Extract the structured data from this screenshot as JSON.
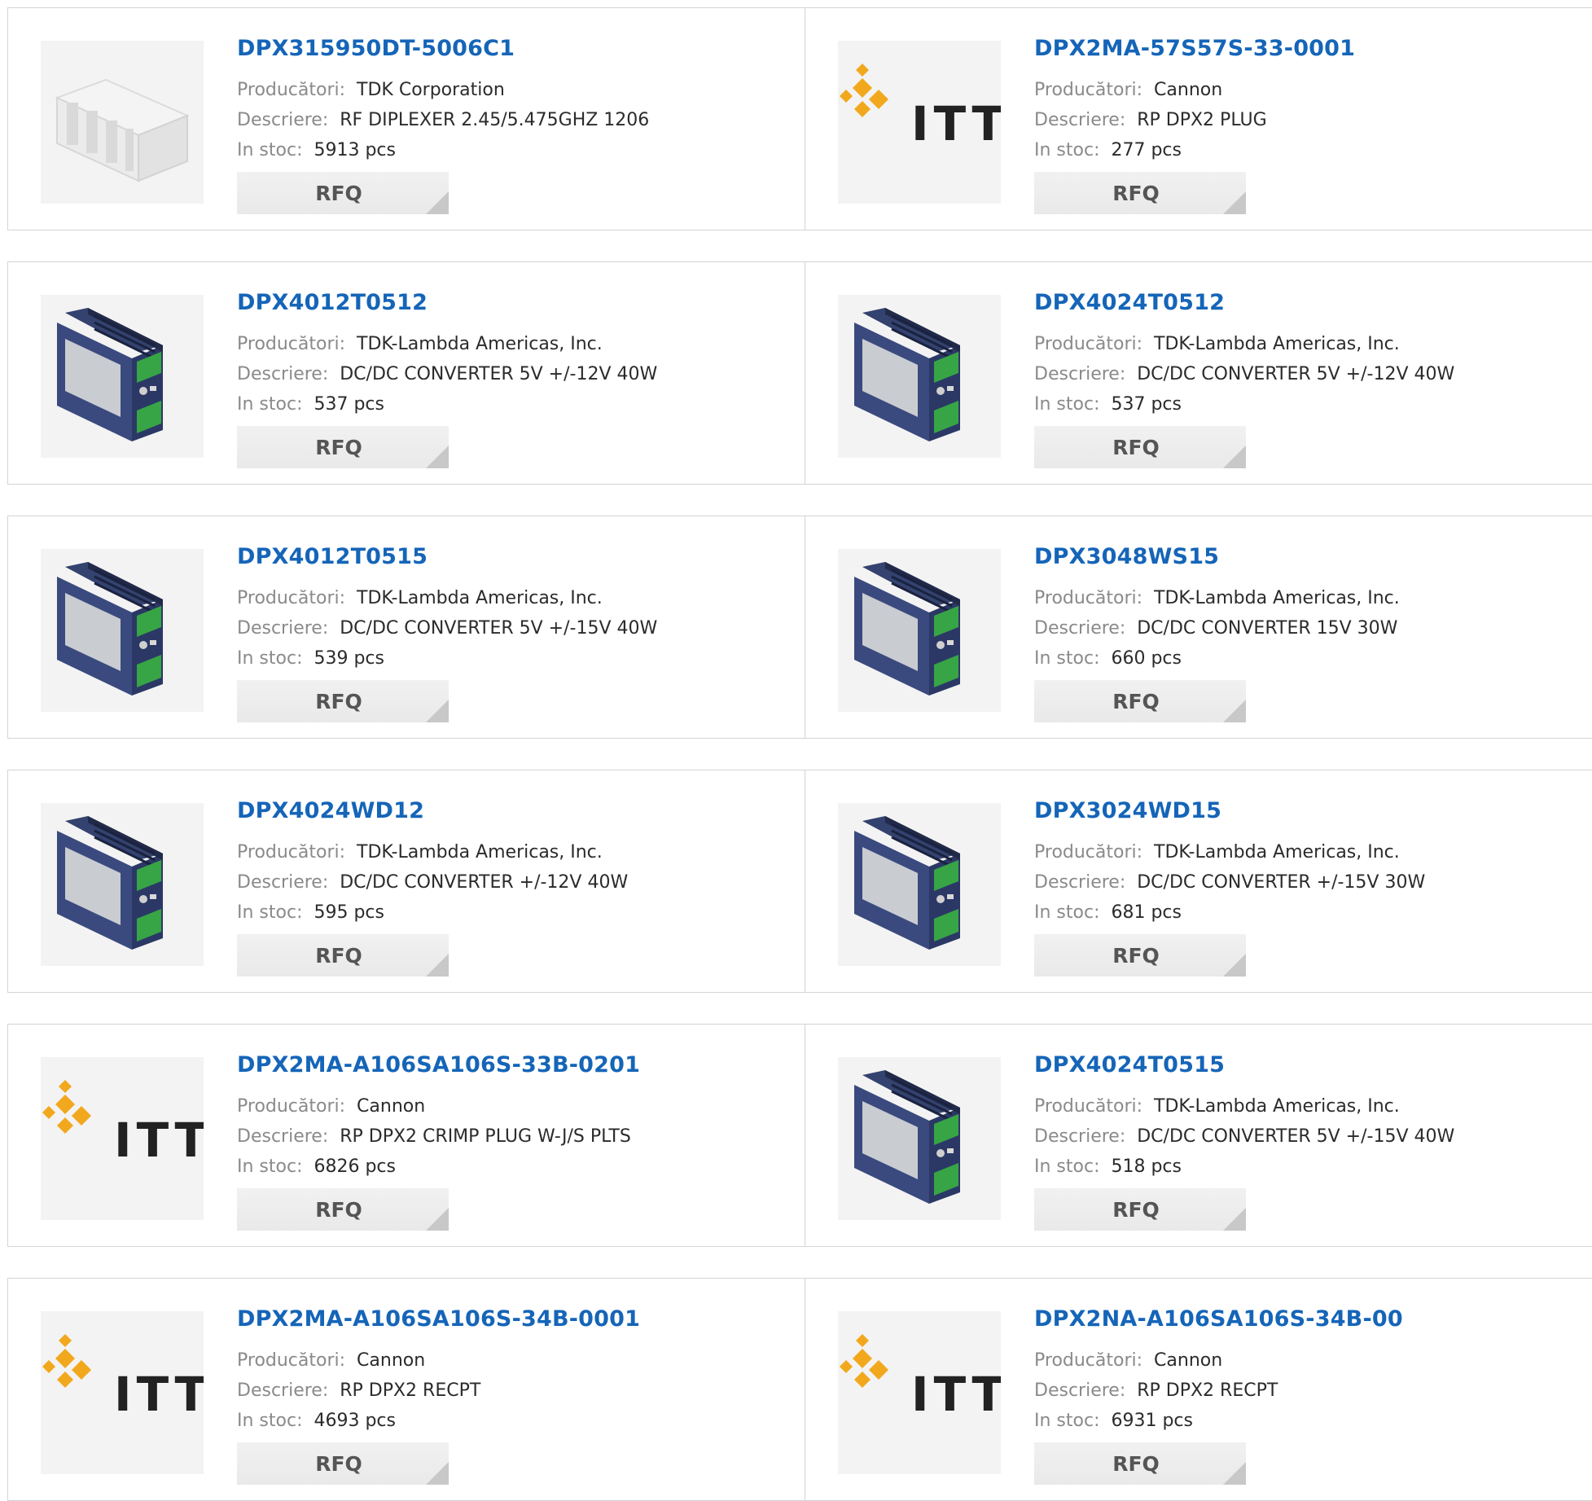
{
  "products": [
    {
      "name": "DPX315950DT-5006C1",
      "manufacturer": "TDK Corporation",
      "description": "RF DIPLEXER 2.45/5.475GHZ 1206",
      "stock": "5913 pcs",
      "image": "chip"
    },
    {
      "name": "DPX2MA-57S57S-33-0001",
      "manufacturer": "Cannon",
      "description": "RP DPX2 PLUG",
      "stock": "277 pcs",
      "image": "itt-logo"
    },
    {
      "name": "DPX4012T0512",
      "manufacturer": "TDK-Lambda Americas, Inc.",
      "description": "DC/DC CONVERTER 5V +/-12V 40W",
      "stock": "537 pcs",
      "image": "dc-converter"
    },
    {
      "name": "DPX4024T0512",
      "manufacturer": "TDK-Lambda Americas, Inc.",
      "description": "DC/DC CONVERTER 5V +/-12V 40W",
      "stock": "537 pcs",
      "image": "dc-converter"
    },
    {
      "name": "DPX4012T0515",
      "manufacturer": "TDK-Lambda Americas, Inc.",
      "description": "DC/DC CONVERTER 5V +/-15V 40W",
      "stock": "539 pcs",
      "image": "dc-converter"
    },
    {
      "name": "DPX3048WS15",
      "manufacturer": "TDK-Lambda Americas, Inc.",
      "description": "DC/DC CONVERTER 15V 30W",
      "stock": "660 pcs",
      "image": "dc-converter"
    },
    {
      "name": "DPX4024WD12",
      "manufacturer": "TDK-Lambda Americas, Inc.",
      "description": "DC/DC CONVERTER +/-12V 40W",
      "stock": "595 pcs",
      "image": "dc-converter"
    },
    {
      "name": "DPX3024WD15",
      "manufacturer": "TDK-Lambda Americas, Inc.",
      "description": "DC/DC CONVERTER +/-15V 30W",
      "stock": "681 pcs",
      "image": "dc-converter"
    },
    {
      "name": "DPX2MA-A106SA106S-33B-0201",
      "manufacturer": "Cannon",
      "description": "RP DPX2 CRIMP PLUG W-J/S PLTS",
      "stock": "6826 pcs",
      "image": "itt-logo"
    },
    {
      "name": "DPX4024T0515",
      "manufacturer": "TDK-Lambda Americas, Inc.",
      "description": "DC/DC CONVERTER 5V +/-15V 40W",
      "stock": "518 pcs",
      "image": "dc-converter"
    },
    {
      "name": "DPX2MA-A106SA106S-34B-0001",
      "manufacturer": "Cannon",
      "description": "RP DPX2 RECPT",
      "stock": "4693 pcs",
      "image": "itt-logo"
    },
    {
      "name": "DPX2NA-A106SA106S-34B-00",
      "manufacturer": "Cannon",
      "description": "RP DPX2 RECPT",
      "stock": "6931 pcs",
      "image": "itt-logo"
    }
  ],
  "labels": {
    "manufacturer": "Producători:",
    "description": "Descriere:",
    "stock": "In stoc:",
    "rfq": "RFQ",
    "logo_text": "ITT"
  },
  "colors": {
    "link": "#1565b8",
    "logo_orange": "#f2a81d"
  }
}
